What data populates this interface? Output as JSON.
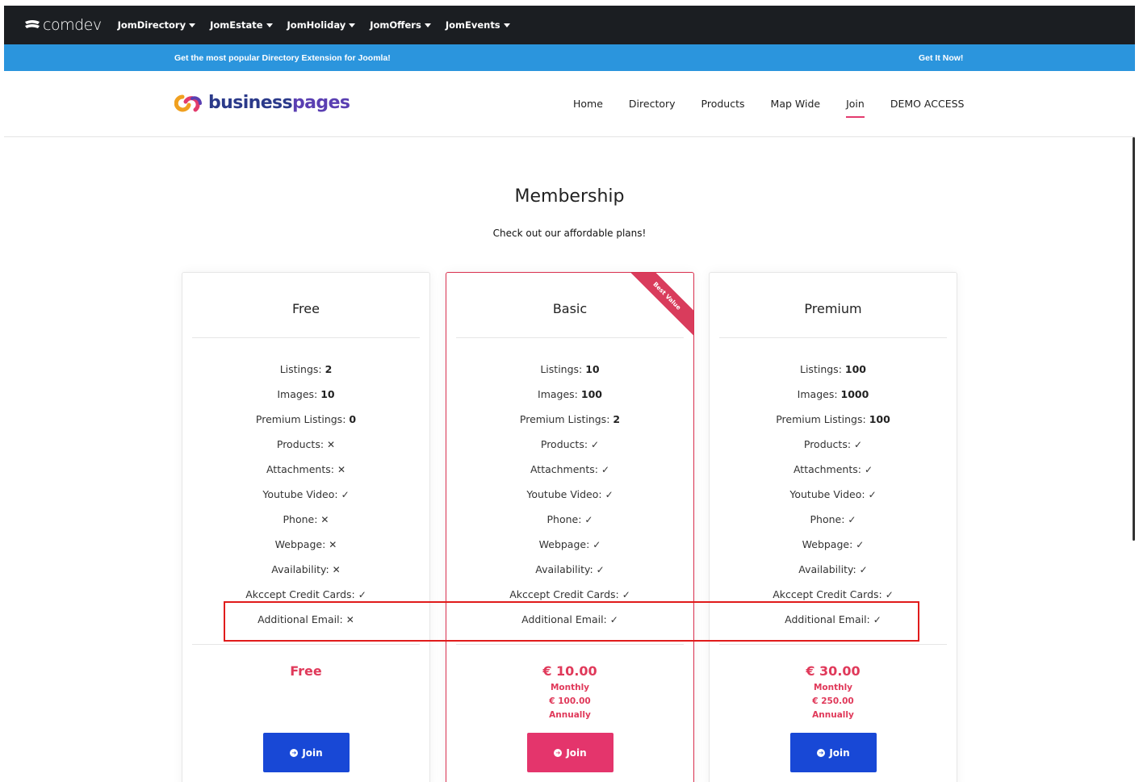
{
  "topbar": {
    "logo_text": "comdev",
    "logo_icon": "comdev-logo-icon",
    "menu": [
      "JomDirectory",
      "JomEstate",
      "JomHoliday",
      "JomOffers",
      "JomEvents"
    ]
  },
  "promo": {
    "text": "Get the most popular Directory Extension for  Joomla!",
    "link": "Get It Now!"
  },
  "header": {
    "brand_part1": "business",
    "brand_part2": "pages",
    "brand_icon": "businesspages-logo-icon",
    "nav": [
      "Home",
      "Directory",
      "Products",
      "Map Wide",
      "Join",
      "DEMO ACCESS"
    ],
    "active_nav": "Join"
  },
  "page": {
    "title": "Membership",
    "subtitle": "Check out our affordable plans!"
  },
  "colors": {
    "accent": "#e0395a",
    "join_blue": "#1848d6",
    "join_pink": "#e4356c",
    "promo_blue": "#2b95dd",
    "topbar": "#1b1e22"
  },
  "plans": [
    {
      "name": "Free",
      "features": [
        {
          "label": "Listings:",
          "value": "2"
        },
        {
          "label": "Images:",
          "value": "10"
        },
        {
          "label": "Premium Listings:",
          "value": "0"
        },
        {
          "label": "Products:",
          "value": "✕"
        },
        {
          "label": "Attachments:",
          "value": "✕"
        },
        {
          "label": "Youtube Video:",
          "value": "✓"
        },
        {
          "label": "Phone:",
          "value": "✕"
        },
        {
          "label": "Webpage:",
          "value": "✕"
        },
        {
          "label": "Availability:",
          "value": "✕"
        },
        {
          "label": "Akccept Credit Cards:",
          "value": "✓"
        },
        {
          "label": "Additional Email:",
          "value": "✕"
        }
      ],
      "price": "Free",
      "price_monthly_label": "",
      "price_annual": "",
      "price_annual_label": "",
      "button": "Join"
    },
    {
      "name": "Basic",
      "ribbon": "Best Value",
      "features": [
        {
          "label": "Listings:",
          "value": "10"
        },
        {
          "label": "Images:",
          "value": "100"
        },
        {
          "label": "Premium Listings:",
          "value": "2"
        },
        {
          "label": "Products:",
          "value": "✓"
        },
        {
          "label": "Attachments:",
          "value": "✓"
        },
        {
          "label": "Youtube Video:",
          "value": "✓"
        },
        {
          "label": "Phone:",
          "value": "✓"
        },
        {
          "label": "Webpage:",
          "value": "✓"
        },
        {
          "label": "Availability:",
          "value": "✓"
        },
        {
          "label": "Akccept Credit Cards:",
          "value": "✓"
        },
        {
          "label": "Additional Email:",
          "value": "✓"
        }
      ],
      "price": "€ 10.00",
      "price_monthly_label": "Monthly",
      "price_annual": "€ 100.00",
      "price_annual_label": "Annually",
      "button": "Join"
    },
    {
      "name": "Premium",
      "features": [
        {
          "label": "Listings:",
          "value": "100"
        },
        {
          "label": "Images:",
          "value": "1000"
        },
        {
          "label": "Premium Listings:",
          "value": "100"
        },
        {
          "label": "Products:",
          "value": "✓"
        },
        {
          "label": "Attachments:",
          "value": "✓"
        },
        {
          "label": "Youtube Video:",
          "value": "✓"
        },
        {
          "label": "Phone:",
          "value": "✓"
        },
        {
          "label": "Webpage:",
          "value": "✓"
        },
        {
          "label": "Availability:",
          "value": "✓"
        },
        {
          "label": "Akccept Credit Cards:",
          "value": "✓"
        },
        {
          "label": "Additional Email:",
          "value": "✓"
        }
      ],
      "price": "€ 30.00",
      "price_monthly_label": "Monthly",
      "price_annual": "€ 250.00",
      "price_annual_label": "Annually",
      "button": "Join"
    }
  ]
}
